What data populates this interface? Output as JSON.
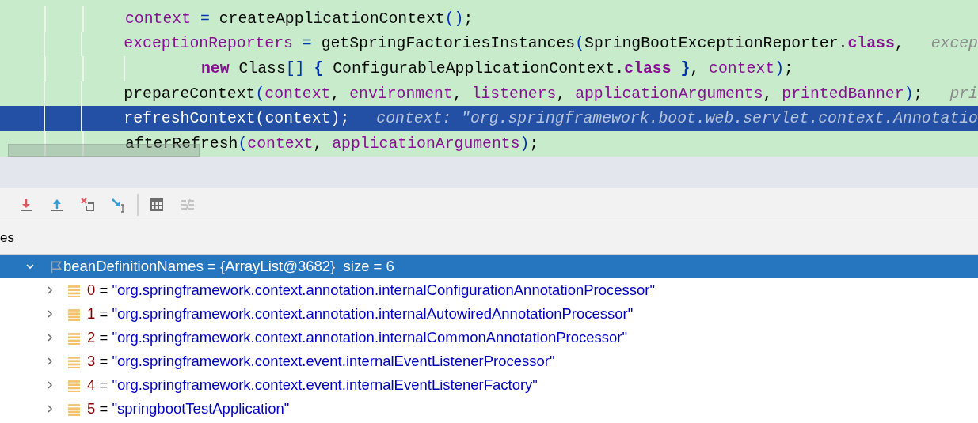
{
  "editor": {
    "lines": [
      {
        "selected": false,
        "continuation": false,
        "tokens": [
          {
            "t": "context",
            "kind": "var"
          },
          {
            "t": " = ",
            "kind": "op"
          },
          {
            "t": "createApplicationContext",
            "kind": "plain"
          },
          {
            "t": "()",
            "kind": "paren"
          },
          {
            "t": ";",
            "kind": "plain"
          }
        ]
      },
      {
        "selected": false,
        "continuation": false,
        "hint": "excep",
        "tokens": [
          {
            "t": "exceptionReporters",
            "kind": "var"
          },
          {
            "t": " = ",
            "kind": "op"
          },
          {
            "t": "getSpringFactoriesInstances",
            "kind": "plain"
          },
          {
            "t": "(",
            "kind": "paren"
          },
          {
            "t": "SpringBootExceptionReporter.",
            "kind": "plain"
          },
          {
            "t": "class",
            "kind": "kw"
          },
          {
            "t": ",",
            "kind": "plain"
          }
        ]
      },
      {
        "selected": false,
        "continuation": true,
        "tokens": [
          {
            "t": "new",
            "kind": "kw"
          },
          {
            "t": " Class",
            "kind": "plain"
          },
          {
            "t": "[]",
            "kind": "paren"
          },
          {
            "t": " {",
            "kind": "brace"
          },
          {
            "t": " ConfigurableApplicationContext.",
            "kind": "plain"
          },
          {
            "t": "class",
            "kind": "kw"
          },
          {
            "t": " }",
            "kind": "brace"
          },
          {
            "t": ", ",
            "kind": "plain"
          },
          {
            "t": "context",
            "kind": "var"
          },
          {
            "t": ")",
            "kind": "paren"
          },
          {
            "t": ";",
            "kind": "plain"
          }
        ]
      },
      {
        "selected": false,
        "continuation": false,
        "hint": "pri",
        "tokens": [
          {
            "t": "prepareContext",
            "kind": "plain"
          },
          {
            "t": "(",
            "kind": "paren"
          },
          {
            "t": "context",
            "kind": "var"
          },
          {
            "t": ", ",
            "kind": "plain"
          },
          {
            "t": "environment",
            "kind": "var"
          },
          {
            "t": ", ",
            "kind": "plain"
          },
          {
            "t": "listeners",
            "kind": "var"
          },
          {
            "t": ", ",
            "kind": "plain"
          },
          {
            "t": "applicationArguments",
            "kind": "var"
          },
          {
            "t": ", ",
            "kind": "plain"
          },
          {
            "t": "printedBanner",
            "kind": "var"
          },
          {
            "t": ")",
            "kind": "paren"
          },
          {
            "t": ";",
            "kind": "plain"
          }
        ]
      },
      {
        "selected": true,
        "continuation": false,
        "hint": "context: \"org.springframework.boot.web.servlet.context.Annotatio",
        "tokens": [
          {
            "t": "refreshContext(context);",
            "kind": "plain"
          }
        ]
      },
      {
        "selected": false,
        "continuation": false,
        "tokens": [
          {
            "t": "afterRefresh",
            "kind": "plain"
          },
          {
            "t": "(",
            "kind": "paren"
          },
          {
            "t": "context",
            "kind": "var"
          },
          {
            "t": ", ",
            "kind": "plain"
          },
          {
            "t": "applicationArguments",
            "kind": "var"
          },
          {
            "t": ")",
            "kind": "paren"
          },
          {
            "t": ";",
            "kind": "plain"
          }
        ]
      }
    ]
  },
  "panel": {
    "tab": "es"
  },
  "variables": [
    {
      "name": "beanDefinitionNames",
      "op": "=",
      "value": "{ArrayList@3682}",
      "extra": "size = 6",
      "selected": true,
      "expanded": true,
      "children": [
        {
          "index": "0",
          "op": "=",
          "value": "\"org.springframework.context.annotation.internalConfigurationAnnotationProcessor\"",
          "expanded": false
        },
        {
          "index": "1",
          "op": "=",
          "value": "\"org.springframework.context.annotation.internalAutowiredAnnotationProcessor\"",
          "expanded": false
        },
        {
          "index": "2",
          "op": "=",
          "value": "\"org.springframework.context.annotation.internalCommonAnnotationProcessor\"",
          "expanded": false
        },
        {
          "index": "3",
          "op": "=",
          "value": "\"org.springframework.context.event.internalEventListenerProcessor\"",
          "expanded": false
        },
        {
          "index": "4",
          "op": "=",
          "value": "\"org.springframework.context.event.internalEventListenerFactory\"",
          "expanded": false
        },
        {
          "index": "5",
          "op": "=",
          "value": "\"springbootTestApplication\"",
          "expanded": false
        }
      ]
    }
  ]
}
